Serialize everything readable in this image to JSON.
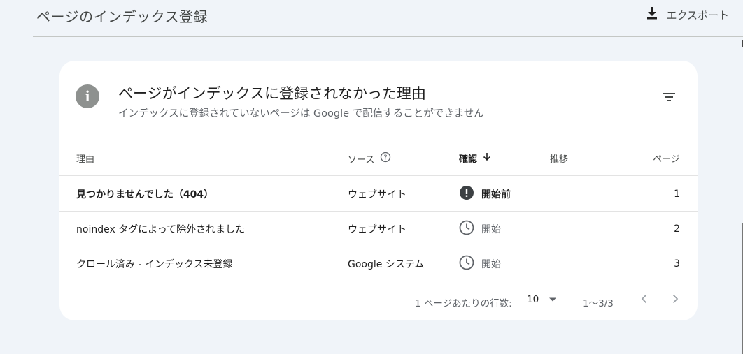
{
  "header": {
    "title": "ページのインデックス登録",
    "export_label": "エクスポート"
  },
  "card": {
    "title": "ページがインデックスに登録されなかった理由",
    "subtitle": "インデックスに登録されていないページは Google で配信することができません",
    "info_icon": "info-icon",
    "filter_icon": "filter-icon"
  },
  "table": {
    "headers": {
      "reason": "理由",
      "source": "ソース",
      "validation": "確認",
      "trend": "推移",
      "pages": "ページ"
    },
    "rows": [
      {
        "reason": "見つかりませんでした（404）",
        "source": "ウェブサイト",
        "status": "開始前",
        "status_icon": "error-icon",
        "pages": "1"
      },
      {
        "reason": "noindex タグによって除外されました",
        "source": "ウェブサイト",
        "status": "開始",
        "status_icon": "clock-icon",
        "pages": "2"
      },
      {
        "reason": "クロール済み - インデックス未登録",
        "source": "Google システム",
        "status": "開始",
        "status_icon": "clock-icon",
        "pages": "3"
      }
    ]
  },
  "pagination": {
    "rows_per_page_label": "1 ページあたりの行数:",
    "rows_per_page_value": "10",
    "range": "1～3/3"
  },
  "colors": {
    "background": "#f0f4f9",
    "card": "#ffffff",
    "error_icon": "#3c4043",
    "muted_icon": "#5f6368"
  }
}
